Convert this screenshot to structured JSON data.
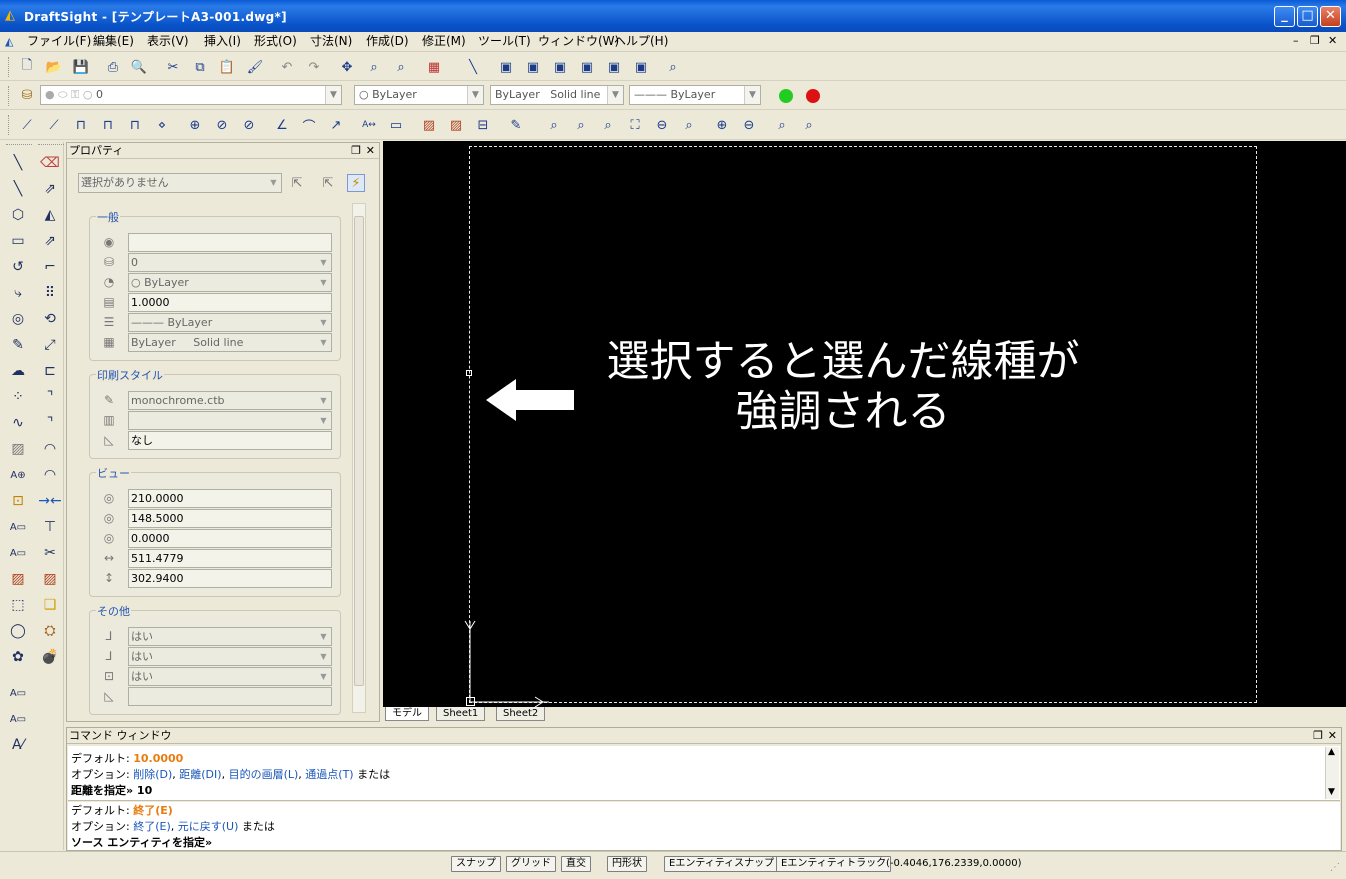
{
  "window": {
    "title": "DraftSight - [テンプレートA3-001.dwg*]"
  },
  "menu": [
    "ファイル(F)",
    "編集(E)",
    "表示(V)",
    "挿入(I)",
    "形式(O)",
    "寸法(N)",
    "作成(D)",
    "修正(M)",
    "ツール(T)",
    "ウィンドウ(W)",
    "ヘルプ(H)"
  ],
  "layer_toolbar": {
    "layer": "0",
    "color": "ByLayer",
    "linestyle": "ByLayer   Solid line",
    "lineweight": "——— ByLayer"
  },
  "properties": {
    "title": "プロパティ",
    "selection": "選択がありません",
    "general_title": "一般",
    "general": {
      "color": "",
      "layer": "0",
      "color_combo": "ByLayer",
      "scale": "1.0000",
      "lineweight": "——— ByLayer",
      "linestyle": "ByLayer     Solid line"
    },
    "print_title": "印刷スタイル",
    "print": {
      "table": "monochrome.ctb",
      "style": "",
      "plot": "なし"
    },
    "view_title": "ビュー",
    "view": {
      "cx": "210.0000",
      "cy": "148.5000",
      "cz": "0.0000",
      "width": "511.4779",
      "height": "302.9400"
    },
    "misc_title": "その他",
    "misc": {
      "ucs_icon": "はい",
      "ucs_origin": "はい",
      "ucs_per_viewport": "はい",
      "ucs_name": ""
    }
  },
  "canvas": {
    "note_line1": "選択すると選んだ線種が",
    "note_line2": "強調される"
  },
  "tabs": [
    "モデル",
    "Sheet1",
    "Sheet2"
  ],
  "command": {
    "title": "コマンド ウィンドウ",
    "l1_label": "デフォルト: ",
    "l1_value": "10.0000",
    "l2_label": "オプション: ",
    "l2_o1": "削除(D)",
    "l2_o2": "距離(DI)",
    "l2_o3": "目的の画層(L)",
    "l2_o4": "通過点(T)",
    "l2_tail": " または",
    "l3": "距離を指定» 10",
    "l4_label": "デフォルト: ",
    "l4_value": "終了(E)",
    "l5_label": "オプション: ",
    "l5_o1": "終了(E)",
    "l5_o2": "元に戻す(U)",
    "l5_tail": " または",
    "l6": "ソース エンティティを指定»"
  },
  "status": {
    "snap": "スナップ",
    "grid": "グリッド",
    "ortho": "直交",
    "polar": "円形状",
    "esnap": "Eエンティティスナップ",
    "etrack": "Eエンティティトラック",
    "coords": "(-0.4046,176.2339,0.0000)"
  },
  "colors": {
    "titlebar": "#0a5ad8",
    "canvas": "#000000",
    "accent_blue": "#1a57b8",
    "default_orange": "#e87c10",
    "green_dot": "#22cc22",
    "red_dot": "#dd1111"
  }
}
